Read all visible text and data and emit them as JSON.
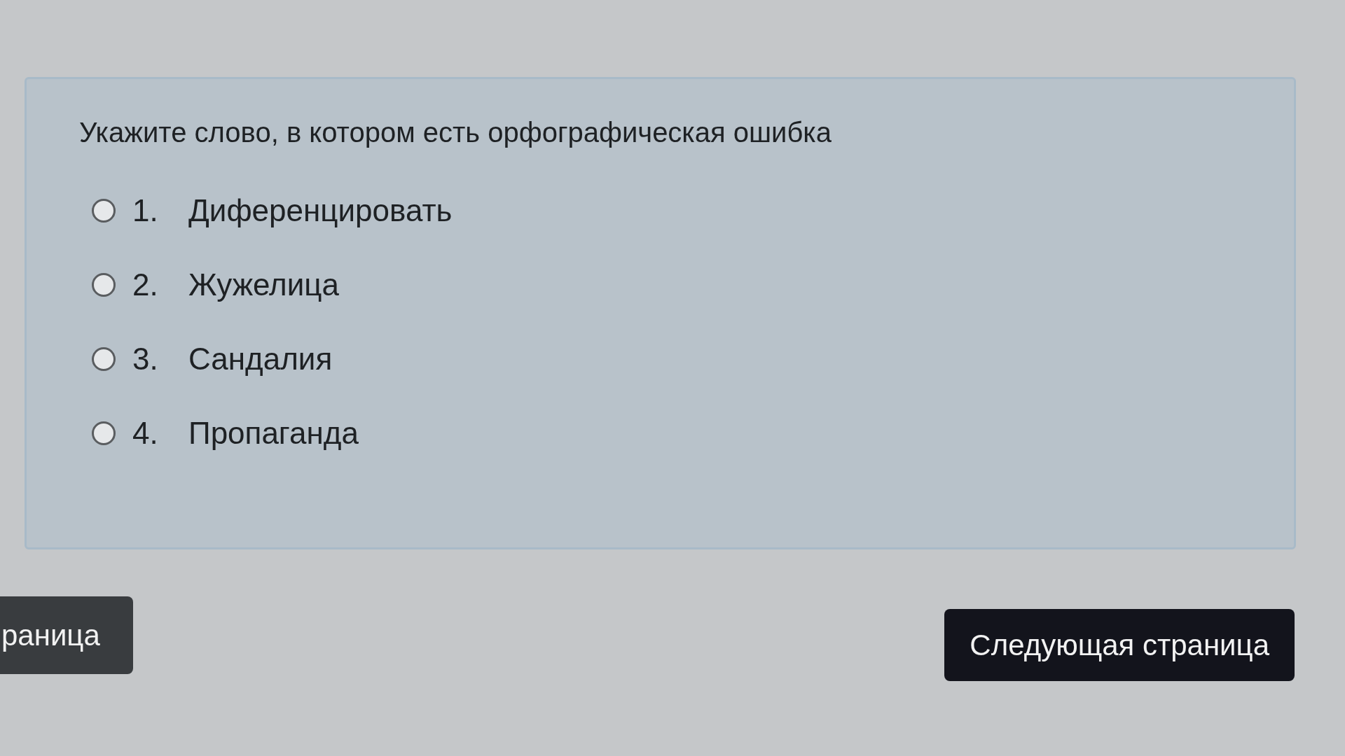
{
  "question": {
    "text": "Укажите слово, в котором есть орфографическая ошибка"
  },
  "options": [
    {
      "number": "1.",
      "label": "Диференцировать",
      "selected": false
    },
    {
      "number": "2.",
      "label": "Жужелица",
      "selected": false
    },
    {
      "number": "3.",
      "label": "Сандалия",
      "selected": false
    },
    {
      "number": "4.",
      "label": "Пропаганда",
      "selected": false
    }
  ],
  "buttons": [
    {
      "kind": "previous",
      "label": "раница"
    },
    {
      "kind": "next",
      "label": "Следующая страница"
    }
  ]
}
